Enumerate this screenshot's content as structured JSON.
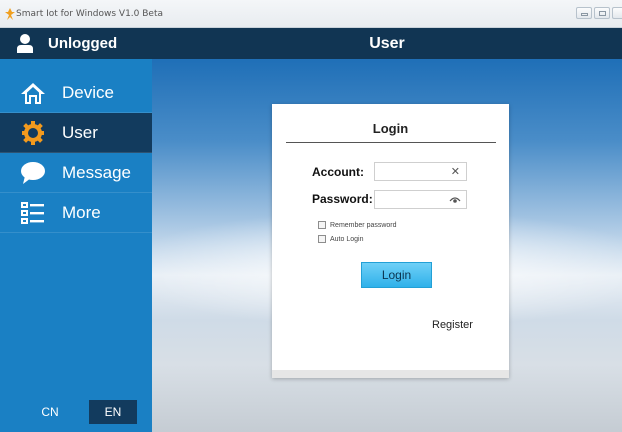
{
  "window": {
    "title": "Smart Iot for Windows V1.0 Beta"
  },
  "sidebar": {
    "status_label": "Unlogged",
    "items": [
      {
        "label": "Device",
        "icon": "home-icon"
      },
      {
        "label": "User",
        "icon": "gear-icon",
        "active": true
      },
      {
        "label": "Message",
        "icon": "chat-bubble-icon"
      },
      {
        "label": "More",
        "icon": "list-icon"
      }
    ],
    "languages": {
      "cn": "CN",
      "en": "EN",
      "selected": "EN"
    }
  },
  "header": {
    "title": "User"
  },
  "login": {
    "title": "Login",
    "account_label": "Account:",
    "account_value": "",
    "password_label": "Password:",
    "password_value": "",
    "remember_label": "Remember password",
    "remember_checked": false,
    "auto_login_label": "Auto Login",
    "auto_login_checked": false,
    "login_button": "Login",
    "register_link": "Register"
  },
  "colors": {
    "sidebar": "#1a80c4",
    "header": "#113553",
    "active": "#123b5e",
    "button": "#2fb1ea"
  }
}
